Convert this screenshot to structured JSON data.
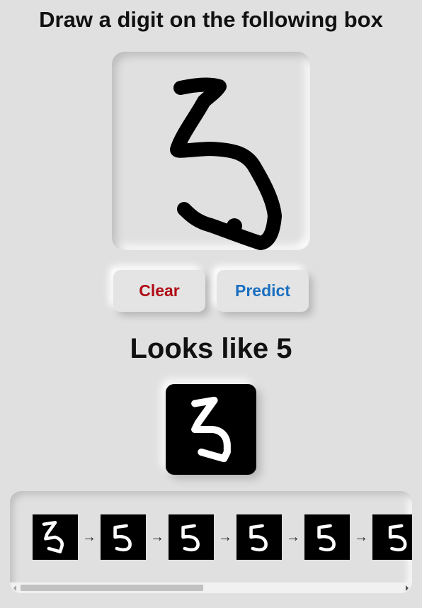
{
  "header": {
    "title": "Draw a digit on the following box"
  },
  "buttons": {
    "clear_label": "Clear",
    "predict_label": "Predict"
  },
  "prediction": {
    "text": "Looks like 5",
    "digit": 5
  },
  "colors": {
    "clear": "#b00d16",
    "predict": "#1a6fc0",
    "background": "#e0e0e0"
  },
  "pipeline": {
    "step_count_visible": 6,
    "arrow_glyph": "→"
  },
  "icons": {
    "arrow": "right-arrow-icon",
    "scroll_left": "scroll-left-arrow-icon",
    "scroll_right": "scroll-right-arrow-icon"
  }
}
